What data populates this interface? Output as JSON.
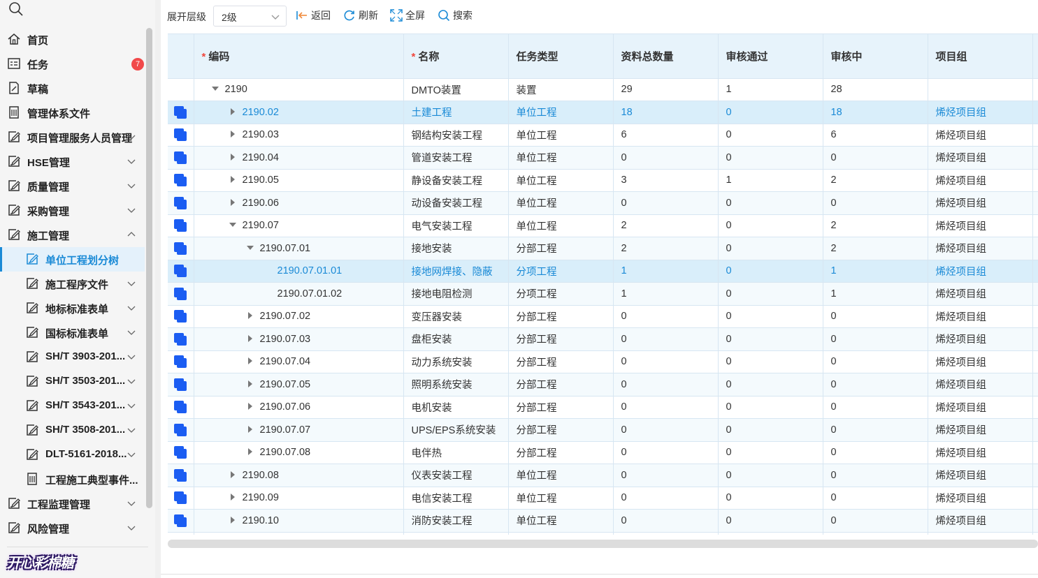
{
  "sidebar": {
    "items": [
      {
        "label": "首页",
        "icon": "home-icon",
        "level": 1,
        "arrow": "",
        "badge": ""
      },
      {
        "label": "任务",
        "icon": "task-list-icon",
        "level": 1,
        "arrow": "",
        "badge": "7"
      },
      {
        "label": "草稿",
        "icon": "draft-icon",
        "level": 1,
        "arrow": "",
        "badge": ""
      },
      {
        "label": "管理体系文件",
        "icon": "document-icon",
        "level": 1,
        "arrow": "",
        "badge": ""
      },
      {
        "label": "项目管理服务人员管理",
        "icon": "edit-icon",
        "level": 1,
        "arrow": "down",
        "badge": ""
      },
      {
        "label": "HSE管理",
        "icon": "edit-icon",
        "level": 1,
        "arrow": "down",
        "badge": ""
      },
      {
        "label": "质量管理",
        "icon": "edit-icon",
        "level": 1,
        "arrow": "down",
        "badge": ""
      },
      {
        "label": "采购管理",
        "icon": "edit-icon",
        "level": 1,
        "arrow": "down",
        "badge": ""
      },
      {
        "label": "施工管理",
        "icon": "edit-icon",
        "level": 1,
        "arrow": "up",
        "badge": ""
      },
      {
        "label": "单位工程划分树",
        "icon": "edit-icon",
        "level": 2,
        "arrow": "",
        "badge": "",
        "active": true
      },
      {
        "label": "施工程序文件",
        "icon": "edit-icon",
        "level": 2,
        "arrow": "down",
        "badge": ""
      },
      {
        "label": "地标标准表单",
        "icon": "edit-icon",
        "level": 2,
        "arrow": "down",
        "badge": ""
      },
      {
        "label": "国标标准表单",
        "icon": "edit-icon",
        "level": 2,
        "arrow": "down",
        "badge": ""
      },
      {
        "label": "SH/T 3903-201...",
        "icon": "edit-icon",
        "level": 2,
        "arrow": "down",
        "badge": ""
      },
      {
        "label": "SH/T 3503-201...",
        "icon": "edit-icon",
        "level": 2,
        "arrow": "down",
        "badge": ""
      },
      {
        "label": "SH/T 3543-201...",
        "icon": "edit-icon",
        "level": 2,
        "arrow": "down",
        "badge": ""
      },
      {
        "label": "SH/T 3508-201...",
        "icon": "edit-icon",
        "level": 2,
        "arrow": "down",
        "badge": ""
      },
      {
        "label": "DLT-5161-2018...",
        "icon": "edit-icon",
        "level": 2,
        "arrow": "down",
        "badge": ""
      },
      {
        "label": "工程施工典型事件...",
        "icon": "document-icon",
        "level": 2,
        "arrow": "",
        "badge": ""
      },
      {
        "label": "工程监理管理",
        "icon": "edit-icon",
        "level": 1,
        "arrow": "down",
        "badge": ""
      },
      {
        "label": "风险管理",
        "icon": "edit-icon",
        "level": 1,
        "arrow": "down",
        "badge": ""
      }
    ],
    "logo_text": "开心彩棉糖"
  },
  "toolbar": {
    "level_label": "展开层级",
    "level_value": "2级",
    "back_label": "返回",
    "refresh_label": "刷新",
    "fullscreen_label": "全屏",
    "search_label": "搜索"
  },
  "table": {
    "headers": {
      "code": "编码",
      "name": "名称",
      "task_type": "任务类型",
      "total": "资料总数量",
      "approved": "审核通过",
      "reviewing": "审核中",
      "group": "项目组"
    },
    "rows": [
      {
        "check": false,
        "depth": 0,
        "toggle": "expanded",
        "code": "2190",
        "name": "DMTO装置",
        "task_type": "装置",
        "total": "29",
        "approved": "1",
        "reviewing": "28",
        "group": ""
      },
      {
        "check": true,
        "depth": 1,
        "toggle": "collapsed",
        "code": "2190.02",
        "name": "土建工程",
        "task_type": "单位工程",
        "total": "18",
        "approved": "0",
        "reviewing": "18",
        "group": "烯烃项目组",
        "selected": true
      },
      {
        "check": true,
        "depth": 1,
        "toggle": "collapsed",
        "code": "2190.03",
        "name": "钢结构安装工程",
        "task_type": "单位工程",
        "total": "6",
        "approved": "0",
        "reviewing": "6",
        "group": "烯烃项目组"
      },
      {
        "check": true,
        "depth": 1,
        "toggle": "collapsed",
        "code": "2190.04",
        "name": "管道安装工程",
        "task_type": "单位工程",
        "total": "0",
        "approved": "0",
        "reviewing": "0",
        "group": "烯烃项目组"
      },
      {
        "check": true,
        "depth": 1,
        "toggle": "collapsed",
        "code": "2190.05",
        "name": "静设备安装工程",
        "task_type": "单位工程",
        "total": "3",
        "approved": "1",
        "reviewing": "2",
        "group": "烯烃项目组"
      },
      {
        "check": true,
        "depth": 1,
        "toggle": "collapsed",
        "code": "2190.06",
        "name": "动设备安装工程",
        "task_type": "单位工程",
        "total": "0",
        "approved": "0",
        "reviewing": "0",
        "group": "烯烃项目组"
      },
      {
        "check": true,
        "depth": 1,
        "toggle": "expanded",
        "code": "2190.07",
        "name": "电气安装工程",
        "task_type": "单位工程",
        "total": "2",
        "approved": "0",
        "reviewing": "2",
        "group": "烯烃项目组"
      },
      {
        "check": true,
        "depth": 2,
        "toggle": "expanded",
        "code": "2190.07.01",
        "name": "接地安装",
        "task_type": "分部工程",
        "total": "2",
        "approved": "0",
        "reviewing": "2",
        "group": "烯烃项目组"
      },
      {
        "check": true,
        "depth": 3,
        "toggle": "",
        "code": "2190.07.01.01",
        "name": "接地网焊接、隐蔽",
        "task_type": "分项工程",
        "total": "1",
        "approved": "0",
        "reviewing": "1",
        "group": "烯烃项目组",
        "selected": true
      },
      {
        "check": true,
        "depth": 3,
        "toggle": "",
        "code": "2190.07.01.02",
        "name": "接地电阻检测",
        "task_type": "分项工程",
        "total": "1",
        "approved": "0",
        "reviewing": "1",
        "group": "烯烃项目组"
      },
      {
        "check": true,
        "depth": 2,
        "toggle": "collapsed",
        "code": "2190.07.02",
        "name": "变压器安装",
        "task_type": "分部工程",
        "total": "0",
        "approved": "0",
        "reviewing": "0",
        "group": "烯烃项目组"
      },
      {
        "check": true,
        "depth": 2,
        "toggle": "collapsed",
        "code": "2190.07.03",
        "name": "盘柜安装",
        "task_type": "分部工程",
        "total": "0",
        "approved": "0",
        "reviewing": "0",
        "group": "烯烃项目组"
      },
      {
        "check": true,
        "depth": 2,
        "toggle": "collapsed",
        "code": "2190.07.04",
        "name": "动力系统安装",
        "task_type": "分部工程",
        "total": "0",
        "approved": "0",
        "reviewing": "0",
        "group": "烯烃项目组"
      },
      {
        "check": true,
        "depth": 2,
        "toggle": "collapsed",
        "code": "2190.07.05",
        "name": "照明系统安装",
        "task_type": "分部工程",
        "total": "0",
        "approved": "0",
        "reviewing": "0",
        "group": "烯烃项目组"
      },
      {
        "check": true,
        "depth": 2,
        "toggle": "collapsed",
        "code": "2190.07.06",
        "name": "电机安装",
        "task_type": "分部工程",
        "total": "0",
        "approved": "0",
        "reviewing": "0",
        "group": "烯烃项目组"
      },
      {
        "check": true,
        "depth": 2,
        "toggle": "collapsed",
        "code": "2190.07.07",
        "name": "UPS/EPS系统安装",
        "task_type": "分部工程",
        "total": "0",
        "approved": "0",
        "reviewing": "0",
        "group": "烯烃项目组"
      },
      {
        "check": true,
        "depth": 2,
        "toggle": "collapsed",
        "code": "2190.07.08",
        "name": "电伴热",
        "task_type": "分部工程",
        "total": "0",
        "approved": "0",
        "reviewing": "0",
        "group": "烯烃项目组"
      },
      {
        "check": true,
        "depth": 1,
        "toggle": "collapsed",
        "code": "2190.08",
        "name": "仪表安装工程",
        "task_type": "单位工程",
        "total": "0",
        "approved": "0",
        "reviewing": "0",
        "group": "烯烃项目组"
      },
      {
        "check": true,
        "depth": 1,
        "toggle": "collapsed",
        "code": "2190.09",
        "name": "电信安装工程",
        "task_type": "单位工程",
        "total": "0",
        "approved": "0",
        "reviewing": "0",
        "group": "烯烃项目组"
      },
      {
        "check": true,
        "depth": 1,
        "toggle": "collapsed",
        "code": "2190.10",
        "name": "消防安装工程",
        "task_type": "单位工程",
        "total": "0",
        "approved": "0",
        "reviewing": "0",
        "group": "烯烃项目组"
      }
    ]
  },
  "colors": {
    "accent": "#1a8ad6",
    "header_bg": "#e7f3fb",
    "selected_bg": "#d9eefa",
    "checkbox": "#1b5df2",
    "badge": "#f1494a"
  }
}
